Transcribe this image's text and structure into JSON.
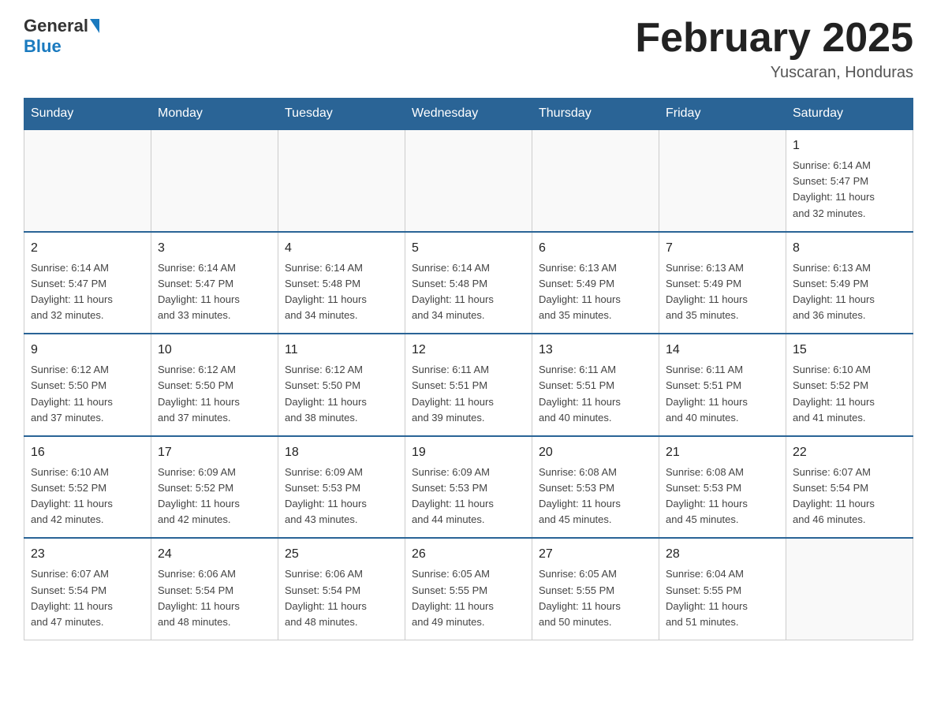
{
  "header": {
    "logo": {
      "general": "General",
      "blue": "Blue"
    },
    "title": "February 2025",
    "location": "Yuscaran, Honduras"
  },
  "weekdays": [
    "Sunday",
    "Monday",
    "Tuesday",
    "Wednesday",
    "Thursday",
    "Friday",
    "Saturday"
  ],
  "weeks": [
    [
      {
        "day": "",
        "info": ""
      },
      {
        "day": "",
        "info": ""
      },
      {
        "day": "",
        "info": ""
      },
      {
        "day": "",
        "info": ""
      },
      {
        "day": "",
        "info": ""
      },
      {
        "day": "",
        "info": ""
      },
      {
        "day": "1",
        "info": "Sunrise: 6:14 AM\nSunset: 5:47 PM\nDaylight: 11 hours\nand 32 minutes."
      }
    ],
    [
      {
        "day": "2",
        "info": "Sunrise: 6:14 AM\nSunset: 5:47 PM\nDaylight: 11 hours\nand 32 minutes."
      },
      {
        "day": "3",
        "info": "Sunrise: 6:14 AM\nSunset: 5:47 PM\nDaylight: 11 hours\nand 33 minutes."
      },
      {
        "day": "4",
        "info": "Sunrise: 6:14 AM\nSunset: 5:48 PM\nDaylight: 11 hours\nand 34 minutes."
      },
      {
        "day": "5",
        "info": "Sunrise: 6:14 AM\nSunset: 5:48 PM\nDaylight: 11 hours\nand 34 minutes."
      },
      {
        "day": "6",
        "info": "Sunrise: 6:13 AM\nSunset: 5:49 PM\nDaylight: 11 hours\nand 35 minutes."
      },
      {
        "day": "7",
        "info": "Sunrise: 6:13 AM\nSunset: 5:49 PM\nDaylight: 11 hours\nand 35 minutes."
      },
      {
        "day": "8",
        "info": "Sunrise: 6:13 AM\nSunset: 5:49 PM\nDaylight: 11 hours\nand 36 minutes."
      }
    ],
    [
      {
        "day": "9",
        "info": "Sunrise: 6:12 AM\nSunset: 5:50 PM\nDaylight: 11 hours\nand 37 minutes."
      },
      {
        "day": "10",
        "info": "Sunrise: 6:12 AM\nSunset: 5:50 PM\nDaylight: 11 hours\nand 37 minutes."
      },
      {
        "day": "11",
        "info": "Sunrise: 6:12 AM\nSunset: 5:50 PM\nDaylight: 11 hours\nand 38 minutes."
      },
      {
        "day": "12",
        "info": "Sunrise: 6:11 AM\nSunset: 5:51 PM\nDaylight: 11 hours\nand 39 minutes."
      },
      {
        "day": "13",
        "info": "Sunrise: 6:11 AM\nSunset: 5:51 PM\nDaylight: 11 hours\nand 40 minutes."
      },
      {
        "day": "14",
        "info": "Sunrise: 6:11 AM\nSunset: 5:51 PM\nDaylight: 11 hours\nand 40 minutes."
      },
      {
        "day": "15",
        "info": "Sunrise: 6:10 AM\nSunset: 5:52 PM\nDaylight: 11 hours\nand 41 minutes."
      }
    ],
    [
      {
        "day": "16",
        "info": "Sunrise: 6:10 AM\nSunset: 5:52 PM\nDaylight: 11 hours\nand 42 minutes."
      },
      {
        "day": "17",
        "info": "Sunrise: 6:09 AM\nSunset: 5:52 PM\nDaylight: 11 hours\nand 42 minutes."
      },
      {
        "day": "18",
        "info": "Sunrise: 6:09 AM\nSunset: 5:53 PM\nDaylight: 11 hours\nand 43 minutes."
      },
      {
        "day": "19",
        "info": "Sunrise: 6:09 AM\nSunset: 5:53 PM\nDaylight: 11 hours\nand 44 minutes."
      },
      {
        "day": "20",
        "info": "Sunrise: 6:08 AM\nSunset: 5:53 PM\nDaylight: 11 hours\nand 45 minutes."
      },
      {
        "day": "21",
        "info": "Sunrise: 6:08 AM\nSunset: 5:53 PM\nDaylight: 11 hours\nand 45 minutes."
      },
      {
        "day": "22",
        "info": "Sunrise: 6:07 AM\nSunset: 5:54 PM\nDaylight: 11 hours\nand 46 minutes."
      }
    ],
    [
      {
        "day": "23",
        "info": "Sunrise: 6:07 AM\nSunset: 5:54 PM\nDaylight: 11 hours\nand 47 minutes."
      },
      {
        "day": "24",
        "info": "Sunrise: 6:06 AM\nSunset: 5:54 PM\nDaylight: 11 hours\nand 48 minutes."
      },
      {
        "day": "25",
        "info": "Sunrise: 6:06 AM\nSunset: 5:54 PM\nDaylight: 11 hours\nand 48 minutes."
      },
      {
        "day": "26",
        "info": "Sunrise: 6:05 AM\nSunset: 5:55 PM\nDaylight: 11 hours\nand 49 minutes."
      },
      {
        "day": "27",
        "info": "Sunrise: 6:05 AM\nSunset: 5:55 PM\nDaylight: 11 hours\nand 50 minutes."
      },
      {
        "day": "28",
        "info": "Sunrise: 6:04 AM\nSunset: 5:55 PM\nDaylight: 11 hours\nand 51 minutes."
      },
      {
        "day": "",
        "info": ""
      }
    ]
  ]
}
